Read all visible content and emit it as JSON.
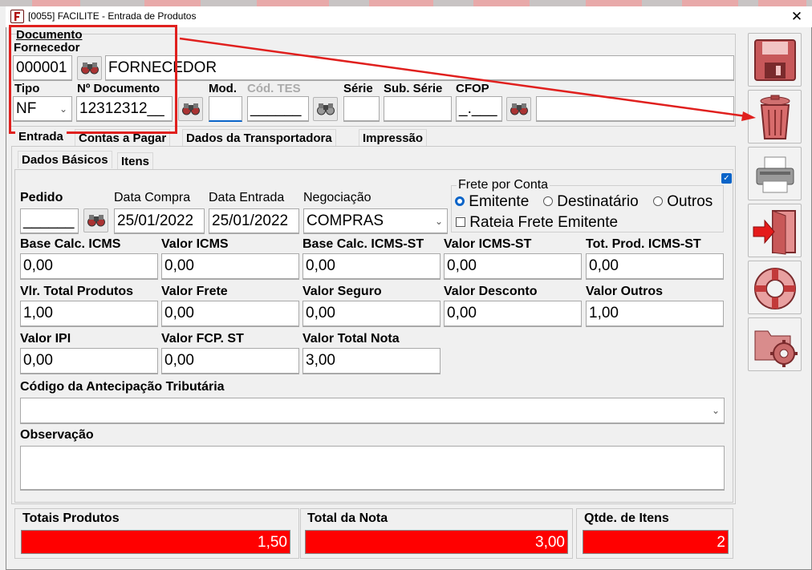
{
  "window": {
    "title": "[0055] FACILITE - Entrada de Produtos",
    "close_glyph": "✕"
  },
  "header": {
    "documento_label": "Documento",
    "fornecedor_label": "Fornecedor",
    "fornecedor_code": "000001",
    "fornecedor_name": "FORNECEDOR",
    "tipo_label": "Tipo",
    "tipo_value": "NF",
    "nro_documento_label": "Nº Documento",
    "nro_documento_value": "12312312__",
    "mod_label": "Mod.",
    "mod_value": "",
    "cod_tes_label": "Cód. TES",
    "cod_tes_value": "______",
    "serie_label": "Série",
    "serie_value": "",
    "sub_serie_label": "Sub. Série",
    "sub_serie_value": "",
    "cfop_label": "CFOP",
    "cfop_value": "_.___",
    "cfop_desc": ""
  },
  "main_tabs": [
    "Entrada",
    "Contas a Pagar",
    "Dados da Transportadora",
    "Impressão"
  ],
  "sub_tabs": [
    "Dados Básicos",
    "Itens"
  ],
  "dados_basicos": {
    "pedido_label": "Pedido",
    "pedido_value": "______",
    "data_compra_label": "Data Compra",
    "data_compra_value": "25/01/2022",
    "data_entrada_label": "Data Entrada",
    "data_entrada_value": "25/01/2022",
    "negociacao_label": "Negociação",
    "negociacao_value": "COMPRAS",
    "frete": {
      "title": "Frete por Conta",
      "options": [
        "Emitente",
        "Destinatário",
        "Outros"
      ],
      "selected": "Emitente",
      "rateia_label": "Rateia Frete Emitente",
      "rateia_checked": false
    },
    "grid": [
      [
        {
          "label": "Base Calc. ICMS",
          "value": "0,00"
        },
        {
          "label": "Valor ICMS",
          "value": "0,00"
        },
        {
          "label": "Base Calc. ICMS-ST",
          "value": "0,00"
        },
        {
          "label": "Valor ICMS-ST",
          "value": "0,00"
        },
        {
          "label": "Tot. Prod. ICMS-ST",
          "value": "0,00"
        }
      ],
      [
        {
          "label": "Vlr. Total Produtos",
          "value": "1,00"
        },
        {
          "label": "Valor Frete",
          "value": "0,00"
        },
        {
          "label": "Valor Seguro",
          "value": "0,00"
        },
        {
          "label": "Valor Desconto",
          "value": "0,00"
        },
        {
          "label": "Valor Outros",
          "value": "1,00"
        }
      ],
      [
        {
          "label": "Valor IPI",
          "value": "0,00"
        },
        {
          "label": "Valor FCP. ST",
          "value": "0,00"
        },
        {
          "label": "Valor Total Nota",
          "value": "3,00"
        }
      ]
    ],
    "antecipacao_label": "Código da Antecipação Tributária",
    "antecipacao_value": "",
    "observacao_label": "Observação",
    "observacao_value": ""
  },
  "totals": {
    "totais_produtos_label": "Totais Produtos",
    "totais_produtos_value": "1,50",
    "total_nota_label": "Total da Nota",
    "total_nota_value": "3,00",
    "qtde_itens_label": "Qtde. de Itens",
    "qtde_itens_value": "2"
  },
  "colors": {
    "accent_red": "#ff0000",
    "annotation_red": "#e0201e",
    "select_blue": "#0a64c8"
  },
  "side_icons": [
    "save-icon",
    "trash-icon",
    "printer-icon",
    "exit-door-icon",
    "lifebuoy-icon",
    "folder-gear-icon"
  ]
}
